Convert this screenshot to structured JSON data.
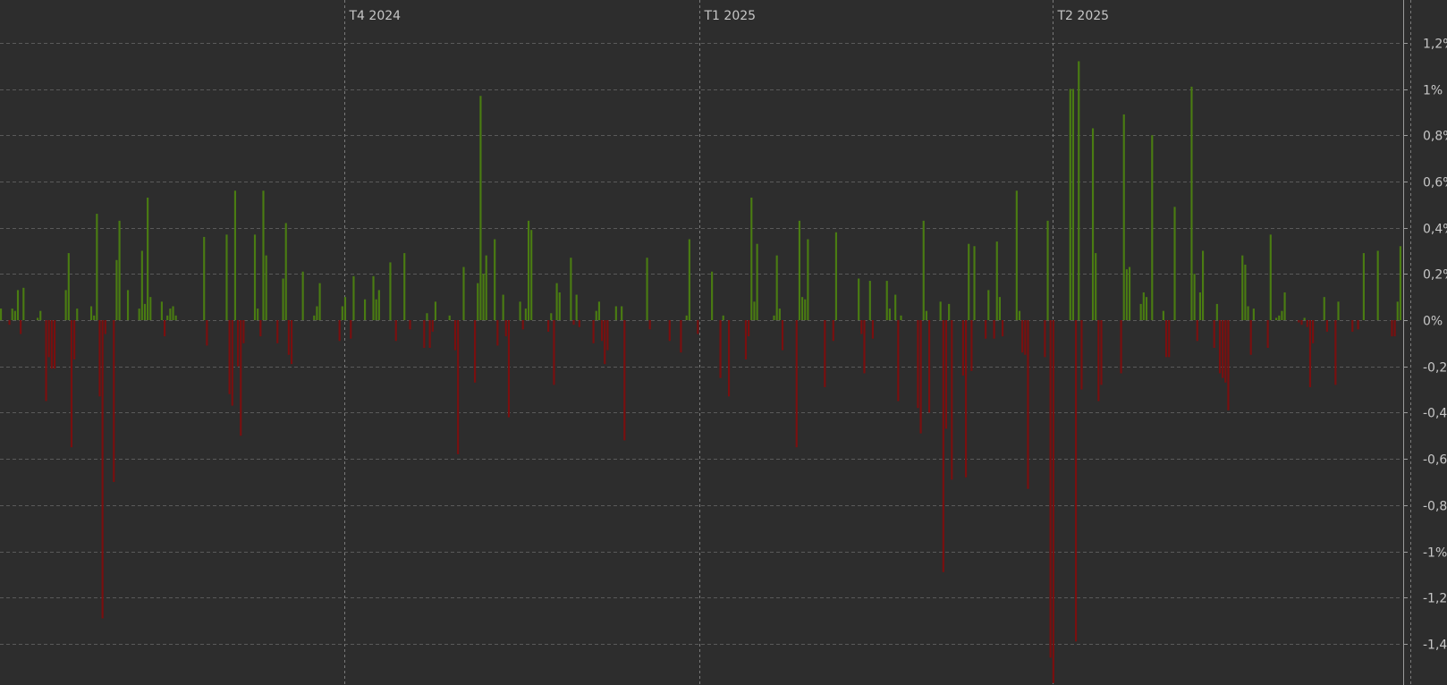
{
  "chart_data": {
    "type": "bar",
    "title": "",
    "xlabel": "",
    "ylabel": "",
    "ylim": [
      -1.55,
      1.2
    ],
    "y_ticks": [
      1.2,
      1.0,
      0.8,
      0.6,
      0.4,
      0.2,
      0.0,
      -0.2,
      -0.4,
      -0.6,
      -0.8,
      -1.0,
      -1.2,
      -1.4
    ],
    "y_tick_labels": [
      "1,2%",
      "1%",
      "0,8%",
      "0,6%",
      "0,4%",
      "0,2%",
      "0%",
      "-0,2%",
      "-0,4%",
      "-0,6%",
      "-0,8%",
      "-1%",
      "-1,2%",
      "-1,4%"
    ],
    "period_labels": [
      "T4 2024",
      "T1 2025",
      "T2 2025"
    ],
    "period_start_index": [
      122,
      248,
      373
    ],
    "current_index": 500,
    "grid": true,
    "legend": "none",
    "colors": {
      "background": "#2d2d2d",
      "positive": "#4a7c12",
      "negative": "#7a0f0f",
      "grid": "#5a5a5a",
      "text": "#c6c6c6"
    },
    "values": [
      0.05,
      0.0,
      0.0,
      -0.02,
      0.05,
      0.04,
      0.13,
      -0.06,
      0.14,
      0.0,
      0.0,
      0.0,
      0.0,
      0.01,
      0.04,
      0.0,
      -0.35,
      -0.16,
      -0.21,
      -0.21,
      0.0,
      0.0,
      0.0,
      0.13,
      0.29,
      -0.55,
      -0.17,
      0.05,
      0.0,
      0.0,
      0.0,
      0.0,
      0.06,
      0.02,
      0.46,
      -0.33,
      -1.29,
      -0.06,
      0.0,
      0.0,
      -0.7,
      0.26,
      0.43,
      0.0,
      0.0,
      0.13,
      0.0,
      0.0,
      0.0,
      0.05,
      0.3,
      0.07,
      0.53,
      0.1,
      0.0,
      0.0,
      0.0,
      0.08,
      -0.07,
      0.02,
      0.05,
      0.06,
      0.02,
      0.0,
      0.0,
      0.0,
      0.0,
      0.0,
      0.0,
      0.0,
      0.0,
      0.0,
      0.36,
      -0.11,
      0.0,
      0.0,
      0.0,
      0.0,
      0.0,
      0.0,
      0.37,
      -0.32,
      -0.37,
      0.56,
      -0.2,
      -0.5,
      -0.1,
      0.0,
      0.0,
      0.0,
      0.37,
      0.05,
      -0.07,
      0.56,
      0.28,
      0.0,
      0.0,
      0.0,
      -0.1,
      0.0,
      0.18,
      0.42,
      -0.15,
      -0.19,
      0.0,
      0.0,
      0.0,
      0.21,
      0.0,
      0.0,
      0.0,
      0.02,
      0.06,
      0.16,
      0.0,
      0.0,
      0.0,
      0.0,
      0.0,
      0.0,
      -0.09,
      0.06,
      0.1,
      0.0,
      -0.08,
      0.19,
      0.0,
      0.0,
      0.0,
      0.09,
      0.0,
      0.0,
      0.19,
      0.09,
      0.13,
      0.0,
      0.0,
      0.0,
      0.25,
      0.0,
      -0.09,
      0.0,
      0.0,
      0.29,
      0.0,
      -0.04,
      0.0,
      0.0,
      0.0,
      0.0,
      -0.12,
      0.03,
      -0.12,
      -0.05,
      0.08,
      0.0,
      0.0,
      0.0,
      0.0,
      0.02,
      0.0,
      -0.13,
      -0.58,
      0.0,
      0.23,
      0.0,
      0.0,
      0.0,
      -0.27,
      0.16,
      0.97,
      0.2,
      0.28,
      0.0,
      0.0,
      0.35,
      -0.11,
      0.0,
      0.11,
      -0.07,
      -0.42,
      0.0,
      0.0,
      0.0,
      0.08,
      -0.04,
      0.05,
      0.43,
      0.39,
      0.0,
      0.0,
      0.0,
      0.0,
      0.0,
      -0.05,
      0.03,
      -0.28,
      0.16,
      0.12,
      0.0,
      0.0,
      0.0,
      0.27,
      -0.02,
      0.11,
      -0.03,
      0.0,
      0.0,
      0.0,
      0.0,
      -0.1,
      0.04,
      0.08,
      -0.09,
      -0.19,
      -0.13,
      0.0,
      0.0,
      0.06,
      0.0,
      0.06,
      -0.52,
      0.0,
      0.0,
      0.0,
      0.0,
      0.0,
      0.0,
      0.0,
      0.27,
      -0.04,
      0.0,
      0.0,
      0.0,
      0.0,
      0.0,
      0.0,
      -0.09,
      0.0,
      0.0,
      0.0,
      -0.14,
      0.0,
      0.02,
      0.35,
      0.0,
      0.0,
      -0.06,
      0.0,
      0.0,
      0.0,
      0.0,
      0.21,
      0.0,
      0.0,
      -0.25,
      0.02,
      0.0,
      -0.33,
      0.0,
      0.0,
      0.0,
      0.0,
      0.0,
      -0.17,
      -0.07,
      0.53,
      0.08,
      0.33,
      0.0,
      0.0,
      0.0,
      0.0,
      0.0,
      0.02,
      0.28,
      0.05,
      -0.13,
      0.0,
      0.0,
      0.0,
      0.0,
      -0.55,
      0.43,
      0.1,
      0.09,
      0.35,
      0.0,
      0.0,
      0.0,
      0.0,
      0.0,
      -0.29,
      0.0,
      0.0,
      -0.09,
      0.38,
      0.0,
      0.0,
      0.0,
      0.0,
      0.0,
      0.0,
      0.0,
      0.18,
      -0.06,
      -0.23,
      0.0,
      0.17,
      -0.08,
      0.0,
      0.0,
      0.0,
      0.0,
      0.17,
      0.05,
      0.0,
      0.11,
      -0.35,
      0.02,
      0.0,
      0.0,
      0.0,
      0.0,
      0.0,
      -0.38,
      -0.49,
      0.43,
      0.04,
      -0.4,
      0.0,
      0.0,
      0.0,
      0.08,
      -1.09,
      -0.47,
      0.07,
      -0.69,
      0.0,
      0.0,
      0.0,
      -0.24,
      -0.68,
      0.33,
      -0.22,
      0.32,
      0.0,
      0.0,
      0.0,
      -0.08,
      0.13,
      0.0,
      -0.08,
      0.34,
      0.1,
      -0.07,
      0.0,
      0.0,
      0.0,
      0.0,
      0.56,
      0.04,
      -0.14,
      -0.15,
      -0.73,
      0.0,
      0.0,
      0.0,
      0.0,
      0.0,
      -0.16,
      0.43,
      -1.46,
      -1.57,
      0.0,
      0.0,
      0.0,
      0.0,
      0.0,
      1.0,
      1.0,
      -1.39,
      1.12,
      -0.3,
      0.0,
      0.0,
      0.0,
      0.83,
      0.29,
      -0.35,
      -0.28,
      0.0,
      0.0,
      0.0,
      0.0,
      0.0,
      0.0,
      -0.23,
      0.89,
      0.22,
      0.23,
      0.0,
      0.0,
      0.0,
      0.07,
      0.12,
      0.1,
      0.0,
      0.8,
      0.0,
      0.0,
      0.0,
      0.04,
      -0.16,
      -0.16,
      0.0,
      0.49,
      0.0,
      0.0,
      0.0,
      0.0,
      0.0,
      1.01,
      0.2,
      -0.09,
      0.12,
      0.3,
      0.0,
      0.0,
      0.0,
      -0.12,
      0.07,
      -0.23,
      -0.25,
      -0.27,
      -0.39,
      0.0,
      0.0,
      0.0,
      0.0,
      0.28,
      0.24,
      0.06,
      -0.15,
      0.05,
      0.0,
      0.0,
      0.0,
      0.0,
      -0.12,
      0.37,
      0.0,
      0.01,
      0.02,
      0.04,
      0.12,
      0.0,
      0.0,
      0.0,
      0.0,
      -0.01,
      -0.02,
      0.01,
      -0.03,
      -0.29,
      -0.1,
      0.0,
      0.0,
      0.0,
      0.1,
      -0.05,
      0.0,
      0.0,
      -0.28,
      0.08,
      0.0,
      0.0,
      0.0,
      0.0,
      -0.05,
      0.0,
      -0.04,
      0.0,
      0.29,
      0.0,
      0.0,
      0.0,
      0.0,
      0.3,
      0.0,
      0.0,
      0.0,
      0.0,
      -0.07,
      -0.07,
      0.08,
      0.32
    ]
  }
}
